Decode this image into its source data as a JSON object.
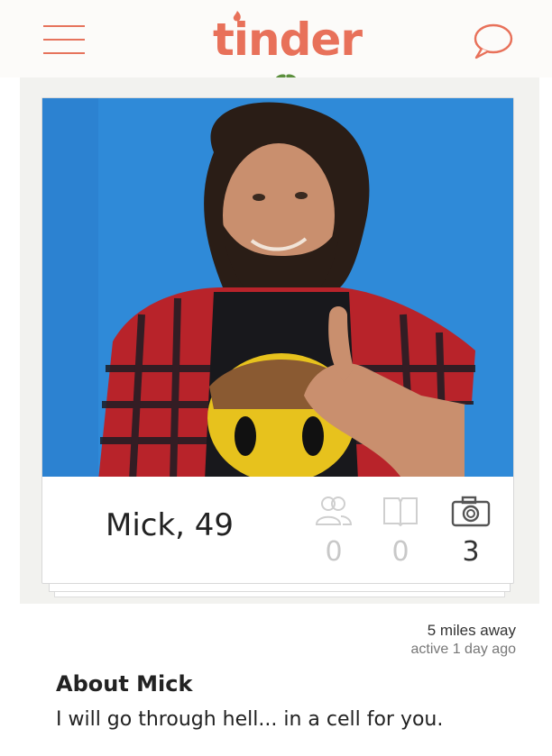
{
  "header": {
    "logo_text": "tinder",
    "menu_icon": "hamburger-menu-icon",
    "chat_icon": "chat-bubble-icon",
    "accent_color": "#e8715a"
  },
  "profile": {
    "name_age": "Mick, 49",
    "stats": [
      {
        "icon": "friends-icon",
        "count": "0"
      },
      {
        "icon": "interests-icon",
        "count": "0"
      },
      {
        "icon": "camera-icon",
        "count": "3"
      }
    ],
    "distance": "5 miles away",
    "last_active": "active 1 day ago"
  },
  "about": {
    "title": "About Mick",
    "text": "I will go through hell... in a cell for you."
  }
}
